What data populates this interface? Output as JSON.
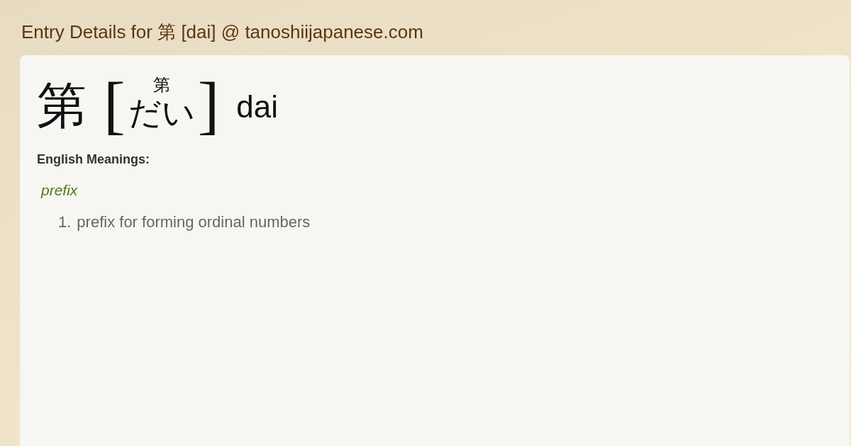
{
  "page_title": "Entry Details for 第 [dai] @ tanoshiijapanese.com",
  "entry": {
    "word": "第",
    "bracket_open": "[",
    "furigana": "第",
    "reading": "だい",
    "bracket_close": "]",
    "romaji": "dai"
  },
  "meanings_label": "English Meanings:",
  "senses": [
    {
      "part_of_speech": "prefix",
      "definitions": [
        {
          "number": "1.",
          "text": "prefix for forming ordinal numbers"
        }
      ]
    }
  ]
}
